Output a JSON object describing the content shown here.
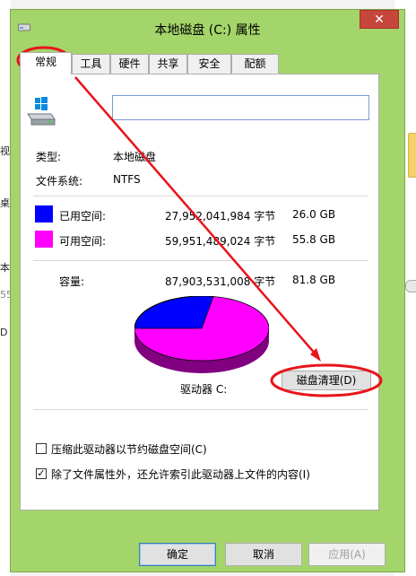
{
  "background": {
    "left_snippets": [
      "视",
      "桌",
      "本",
      "55",
      "D"
    ]
  },
  "window": {
    "title": "本地磁盘 (C:) 属性",
    "close_label": "✕"
  },
  "tabs": [
    {
      "label": "常规",
      "active": true
    },
    {
      "label": "工具",
      "active": false
    },
    {
      "label": "硬件",
      "active": false
    },
    {
      "label": "共享",
      "active": false
    },
    {
      "label": "安全",
      "active": false
    },
    {
      "label": "配额",
      "active": false
    }
  ],
  "general": {
    "name_value": "",
    "type_label": "类型:",
    "type_value": "本地磁盘",
    "fs_label": "文件系统:",
    "fs_value": "NTFS",
    "used": {
      "label": "已用空间:",
      "bytes": "27,952,041,984 字节",
      "size": "26.0 GB",
      "color": "#0000ff"
    },
    "free": {
      "label": "可用空间:",
      "bytes": "59,951,489,024 字节",
      "size": "55.8 GB",
      "color": "#ff00ff"
    },
    "capacity": {
      "label": "容量:",
      "bytes": "87,903,531,008 字节",
      "size": "81.8 GB"
    },
    "drive_label": "驱动器 C:",
    "cleanup_label": "磁盘清理(D)",
    "compress_label": "压缩此驱动器以节约磁盘空间(C)",
    "compress_checked": false,
    "index_label": "除了文件属性外，还允许索引此驱动器上文件的内容(I)",
    "index_checked": true
  },
  "buttons": {
    "ok": "确定",
    "cancel": "取消",
    "apply": "应用(A)"
  },
  "colors": {
    "window_frame": "#a4d56a",
    "close": "#c7463c",
    "annotation": "#e8141b"
  },
  "icons": {
    "title": "drive-icon",
    "drive": "windows-drive-icon"
  }
}
